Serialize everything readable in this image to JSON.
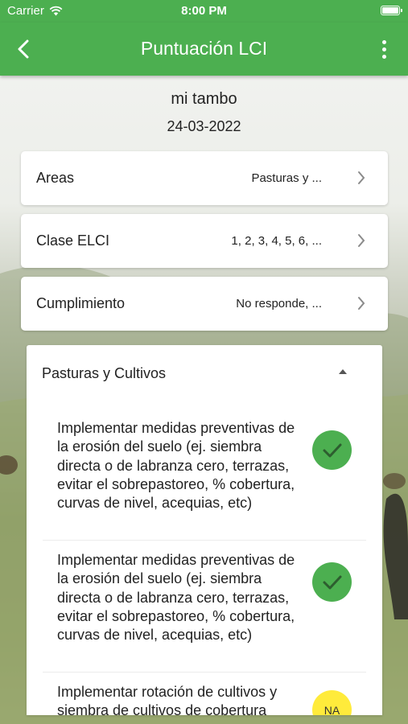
{
  "status_bar": {
    "carrier": "Carrier",
    "time": "8:00 PM"
  },
  "app_bar": {
    "title": "Puntuación LCI",
    "back_icon": "chevron-left-icon",
    "menu_icon": "more-vertical-icon"
  },
  "header": {
    "farm_name": "mi tambo",
    "date": "24-03-2022"
  },
  "filters": [
    {
      "label": "Areas",
      "value": "Pasturas y ..."
    },
    {
      "label": "Clase ELCI",
      "value": "1, 2, 3, 4, 5, 6, ..."
    },
    {
      "label": "Cumplimiento",
      "value": "No responde, ..."
    }
  ],
  "section": {
    "title": "Pasturas y Cultivos",
    "expanded": true,
    "items": [
      {
        "text": "Implementar medidas preventivas de la erosión del suelo (ej. siembra directa o de labranza cero, terrazas, evitar el sobrepastoreo, % cobertura, curvas de nivel, acequias, etc)",
        "status": "check",
        "status_color": "#4caf50"
      },
      {
        "text": "Implementar medidas preventivas de la erosión del suelo (ej. siembra directa o de labranza cero, terrazas, evitar el sobrepastoreo, % cobertura, curvas de nivel, acequias, etc)",
        "status": "check",
        "status_color": "#4caf50"
      },
      {
        "text": "Implementar rotación de cultivos y siembra de cultivos de cobertura",
        "status": "NA",
        "status_color": "#ffeb3b"
      }
    ]
  },
  "colors": {
    "primary": "#4caf50",
    "na": "#ffeb3b"
  }
}
